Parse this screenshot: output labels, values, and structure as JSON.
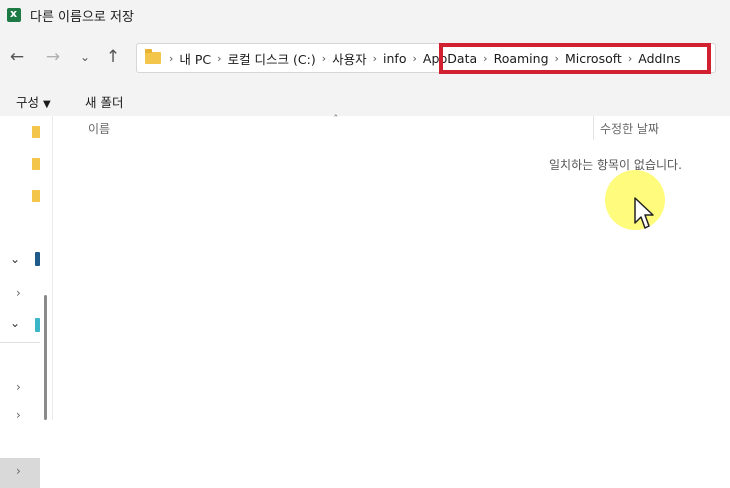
{
  "window": {
    "title": "다른 이름으로 저장",
    "app_icon": "excel-icon"
  },
  "nav": {
    "back_icon": "arrow-left-icon",
    "forward_icon": "arrow-right-icon",
    "recent_icon": "chevron-down-icon",
    "up_icon": "arrow-up-icon"
  },
  "address": {
    "crumbs": [
      "내 PC",
      "로컬 디스크 (C:)",
      "사용자",
      "info",
      "AppData",
      "Roaming",
      "Microsoft",
      "AddIns"
    ],
    "highlight_color": "#d1202f"
  },
  "toolbar": {
    "organize_label": "구성",
    "new_folder_label": "새 폴더"
  },
  "filelist": {
    "col_name": "이름",
    "col_modified": "수정한 날짜",
    "sort_icon": "sort-up-icon",
    "empty_message": "일치하는 항목이 없습니다."
  },
  "colors": {
    "chrome_bg": "#f3f3f3",
    "folder": "#f3c64b",
    "cursor_highlight": "#fffa50"
  }
}
